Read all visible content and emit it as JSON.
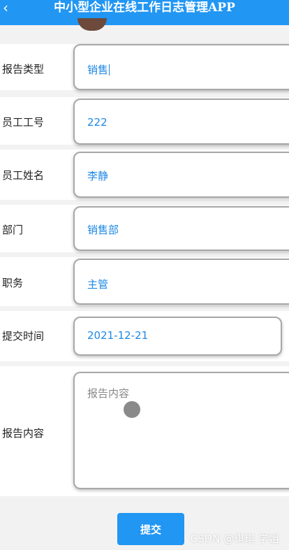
{
  "header": {
    "title": "中小型企业在线工作日志管理APP",
    "back_icon": "‹",
    "background": "#2196f3"
  },
  "form": {
    "fields": [
      {
        "label": "报告类型",
        "value": "销售",
        "focused": true
      },
      {
        "label": "员工工号",
        "value": "222"
      },
      {
        "label": "员工姓名",
        "value": "李静"
      },
      {
        "label": "部门",
        "value": "销售部"
      },
      {
        "label": "职务",
        "value": "主管"
      },
      {
        "label": "提交时间",
        "value": "2021-12-21"
      }
    ],
    "content": {
      "label": "报告内容",
      "placeholder": "报告内容"
    }
  },
  "submit_label": "提交",
  "watermark": "CSDN @琪琪 学姐",
  "colors": {
    "accent": "#2196f3",
    "value_text": "#1e88e5"
  }
}
